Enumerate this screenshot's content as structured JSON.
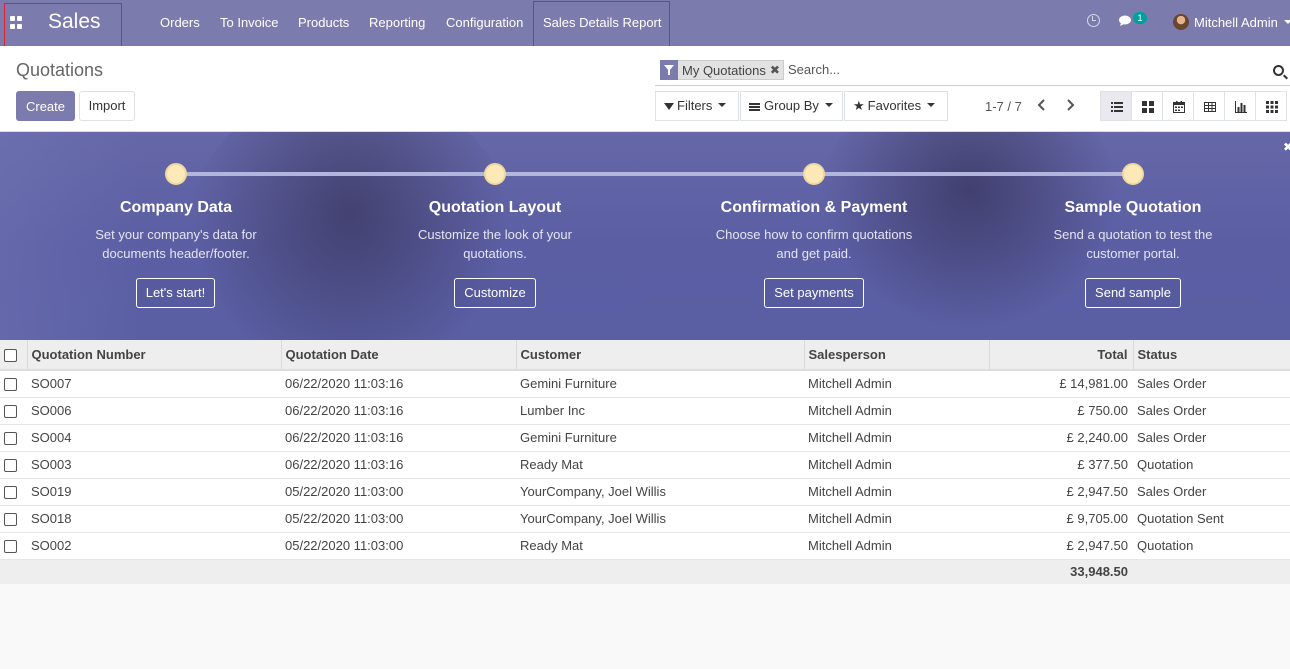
{
  "topbar": {
    "brand": "Sales",
    "menu": [
      "Orders",
      "To Invoice",
      "Products",
      "Reporting",
      "Configuration",
      "Sales Details Report"
    ],
    "chat_badge": "1",
    "user": "Mitchell Admin"
  },
  "control_panel": {
    "breadcrumb": "Quotations",
    "create_label": "Create",
    "import_label": "Import",
    "facet": "My Quotations",
    "search_placeholder": "Search...",
    "filters_label": "Filters",
    "groupby_label": "Group By",
    "favorites_label": "Favorites",
    "pager": "1-7 / 7"
  },
  "onboarding": {
    "steps": [
      {
        "title": "Company Data",
        "desc1": "Set your company's data for",
        "desc2": "documents header/footer.",
        "button": "Let's start!"
      },
      {
        "title": "Quotation Layout",
        "desc1": "Customize the look of your",
        "desc2": "quotations.",
        "button": "Customize"
      },
      {
        "title": "Confirmation & Payment",
        "desc1": "Choose how to confirm quotations",
        "desc2": "and get paid.",
        "button": "Set payments"
      },
      {
        "title": "Sample Quotation",
        "desc1": "Send a quotation to test the",
        "desc2": "customer portal.",
        "button": "Send sample"
      }
    ]
  },
  "table": {
    "columns": [
      "Quotation Number",
      "Quotation Date",
      "Customer",
      "Salesperson",
      "Total",
      "Status"
    ],
    "rows": [
      {
        "number": "SO007",
        "date": "06/22/2020 11:03:16",
        "customer": "Gemini Furniture",
        "salesperson": "Mitchell Admin",
        "total": "£ 14,981.00",
        "status": "Sales Order"
      },
      {
        "number": "SO006",
        "date": "06/22/2020 11:03:16",
        "customer": "Lumber Inc",
        "salesperson": "Mitchell Admin",
        "total": "£ 750.00",
        "status": "Sales Order"
      },
      {
        "number": "SO004",
        "date": "06/22/2020 11:03:16",
        "customer": "Gemini Furniture",
        "salesperson": "Mitchell Admin",
        "total": "£ 2,240.00",
        "status": "Sales Order"
      },
      {
        "number": "SO003",
        "date": "06/22/2020 11:03:16",
        "customer": "Ready Mat",
        "salesperson": "Mitchell Admin",
        "total": "£ 377.50",
        "status": "Quotation"
      },
      {
        "number": "SO019",
        "date": "05/22/2020 11:03:00",
        "customer": "YourCompany, Joel Willis",
        "salesperson": "Mitchell Admin",
        "total": "£ 2,947.50",
        "status": "Sales Order"
      },
      {
        "number": "SO018",
        "date": "05/22/2020 11:03:00",
        "customer": "YourCompany, Joel Willis",
        "salesperson": "Mitchell Admin",
        "total": "£ 9,705.00",
        "status": "Quotation Sent"
      },
      {
        "number": "SO002",
        "date": "05/22/2020 11:03:00",
        "customer": "Ready Mat",
        "salesperson": "Mitchell Admin",
        "total": "£ 2,947.50",
        "status": "Quotation"
      }
    ],
    "sum_total": "33,948.50"
  },
  "colors": {
    "brand": "#7c7bad",
    "banner": "#5b5ea3",
    "highlight_box": "#e0202a"
  }
}
